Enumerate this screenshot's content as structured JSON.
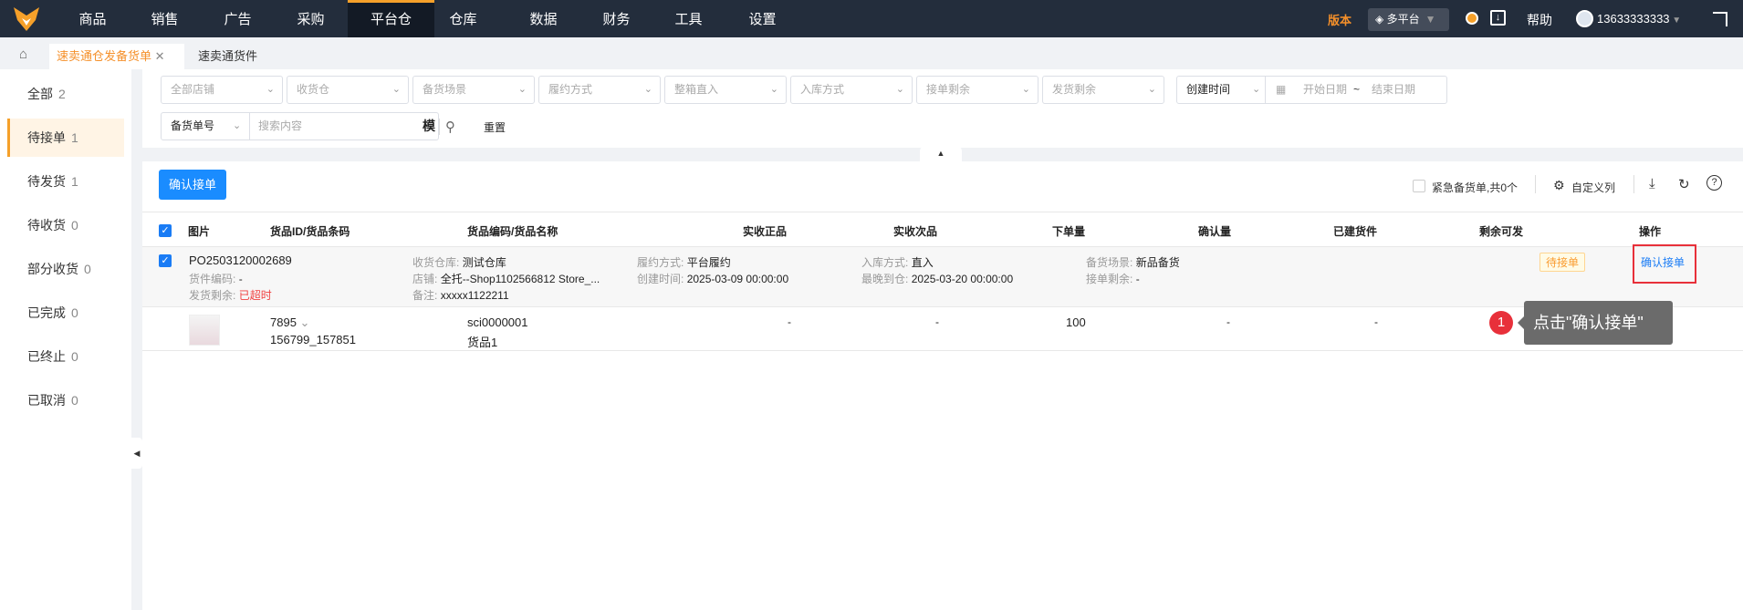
{
  "nav": {
    "items": [
      "商品",
      "销售",
      "广告",
      "采购",
      "平台仓",
      "仓库",
      "数据",
      "财务",
      "工具",
      "设置"
    ],
    "active": "平台仓",
    "version": "版本",
    "platform": "多平台",
    "help": "帮助",
    "user": "13633333333"
  },
  "tabs": [
    {
      "label": "速卖通仓发备货单",
      "active": true
    },
    {
      "label": "速卖通货件",
      "active": false
    }
  ],
  "sidebar": [
    {
      "label": "全部",
      "count": "2"
    },
    {
      "label": "待接单",
      "count": "1"
    },
    {
      "label": "待发货",
      "count": "1"
    },
    {
      "label": "待收货",
      "count": "0"
    },
    {
      "label": "部分收货",
      "count": "0"
    },
    {
      "label": "已完成",
      "count": "0"
    },
    {
      "label": "已终止",
      "count": "0"
    },
    {
      "label": "已取消",
      "count": "0"
    }
  ],
  "filters": {
    "selects": [
      "全部店铺",
      "收货仓",
      "备货场景",
      "履约方式",
      "整箱直入",
      "入库方式",
      "接单剩余",
      "发货剩余"
    ],
    "time_type": "创建时间",
    "start_date": "开始日期",
    "range_sep": "~",
    "end_date": "结束日期",
    "search_type": "备货单号",
    "search_placeholder": "搜索内容",
    "fuzzy": "模",
    "reset": "重置"
  },
  "toolbar": {
    "confirm": "确认接单",
    "urgent": "紧急备货单,共0个",
    "custom_cols": "自定义列"
  },
  "table": {
    "headers": [
      "图片",
      "货品ID/货品条码",
      "货品编码/货品名称",
      "实收正品",
      "实收次品",
      "下单量",
      "确认量",
      "已建货件",
      "剩余可发",
      "操作"
    ],
    "order": {
      "po": "PO2503120002689",
      "shipment_code_label": "货件编码:",
      "shipment_code": "-",
      "ship_left_label": "发货剩余:",
      "ship_left": "已超时",
      "warehouse_label": "收货仓库:",
      "warehouse": "测试仓库",
      "store_label": "店铺:",
      "store": "全托--Shop1102566812 Store_...",
      "note_label": "备注:",
      "note": "xxxxx1122211",
      "fulfill_label": "履约方式:",
      "fulfill": "平台履约",
      "created_label": "创建时间:",
      "created": "2025-03-09 00:00:00",
      "inbound_label": "入库方式:",
      "inbound": "直入",
      "latest_label": "最晚到仓:",
      "latest": "2025-03-20 00:00:00",
      "scene_label": "备货场景:",
      "scene": "新品备货",
      "accept_left_label": "接单剩余:",
      "accept_left": "-",
      "status": "待接单",
      "action": "确认接单"
    },
    "item": {
      "id": "7895",
      "barcode": "156799_157851",
      "code": "sci0000001",
      "name": "货品1",
      "good": "-",
      "defect": "-",
      "ordered": "100",
      "confirmed": "-",
      "shipments": "-"
    }
  },
  "tooltip": {
    "step": "1",
    "text": "点击\"确认接单\""
  }
}
